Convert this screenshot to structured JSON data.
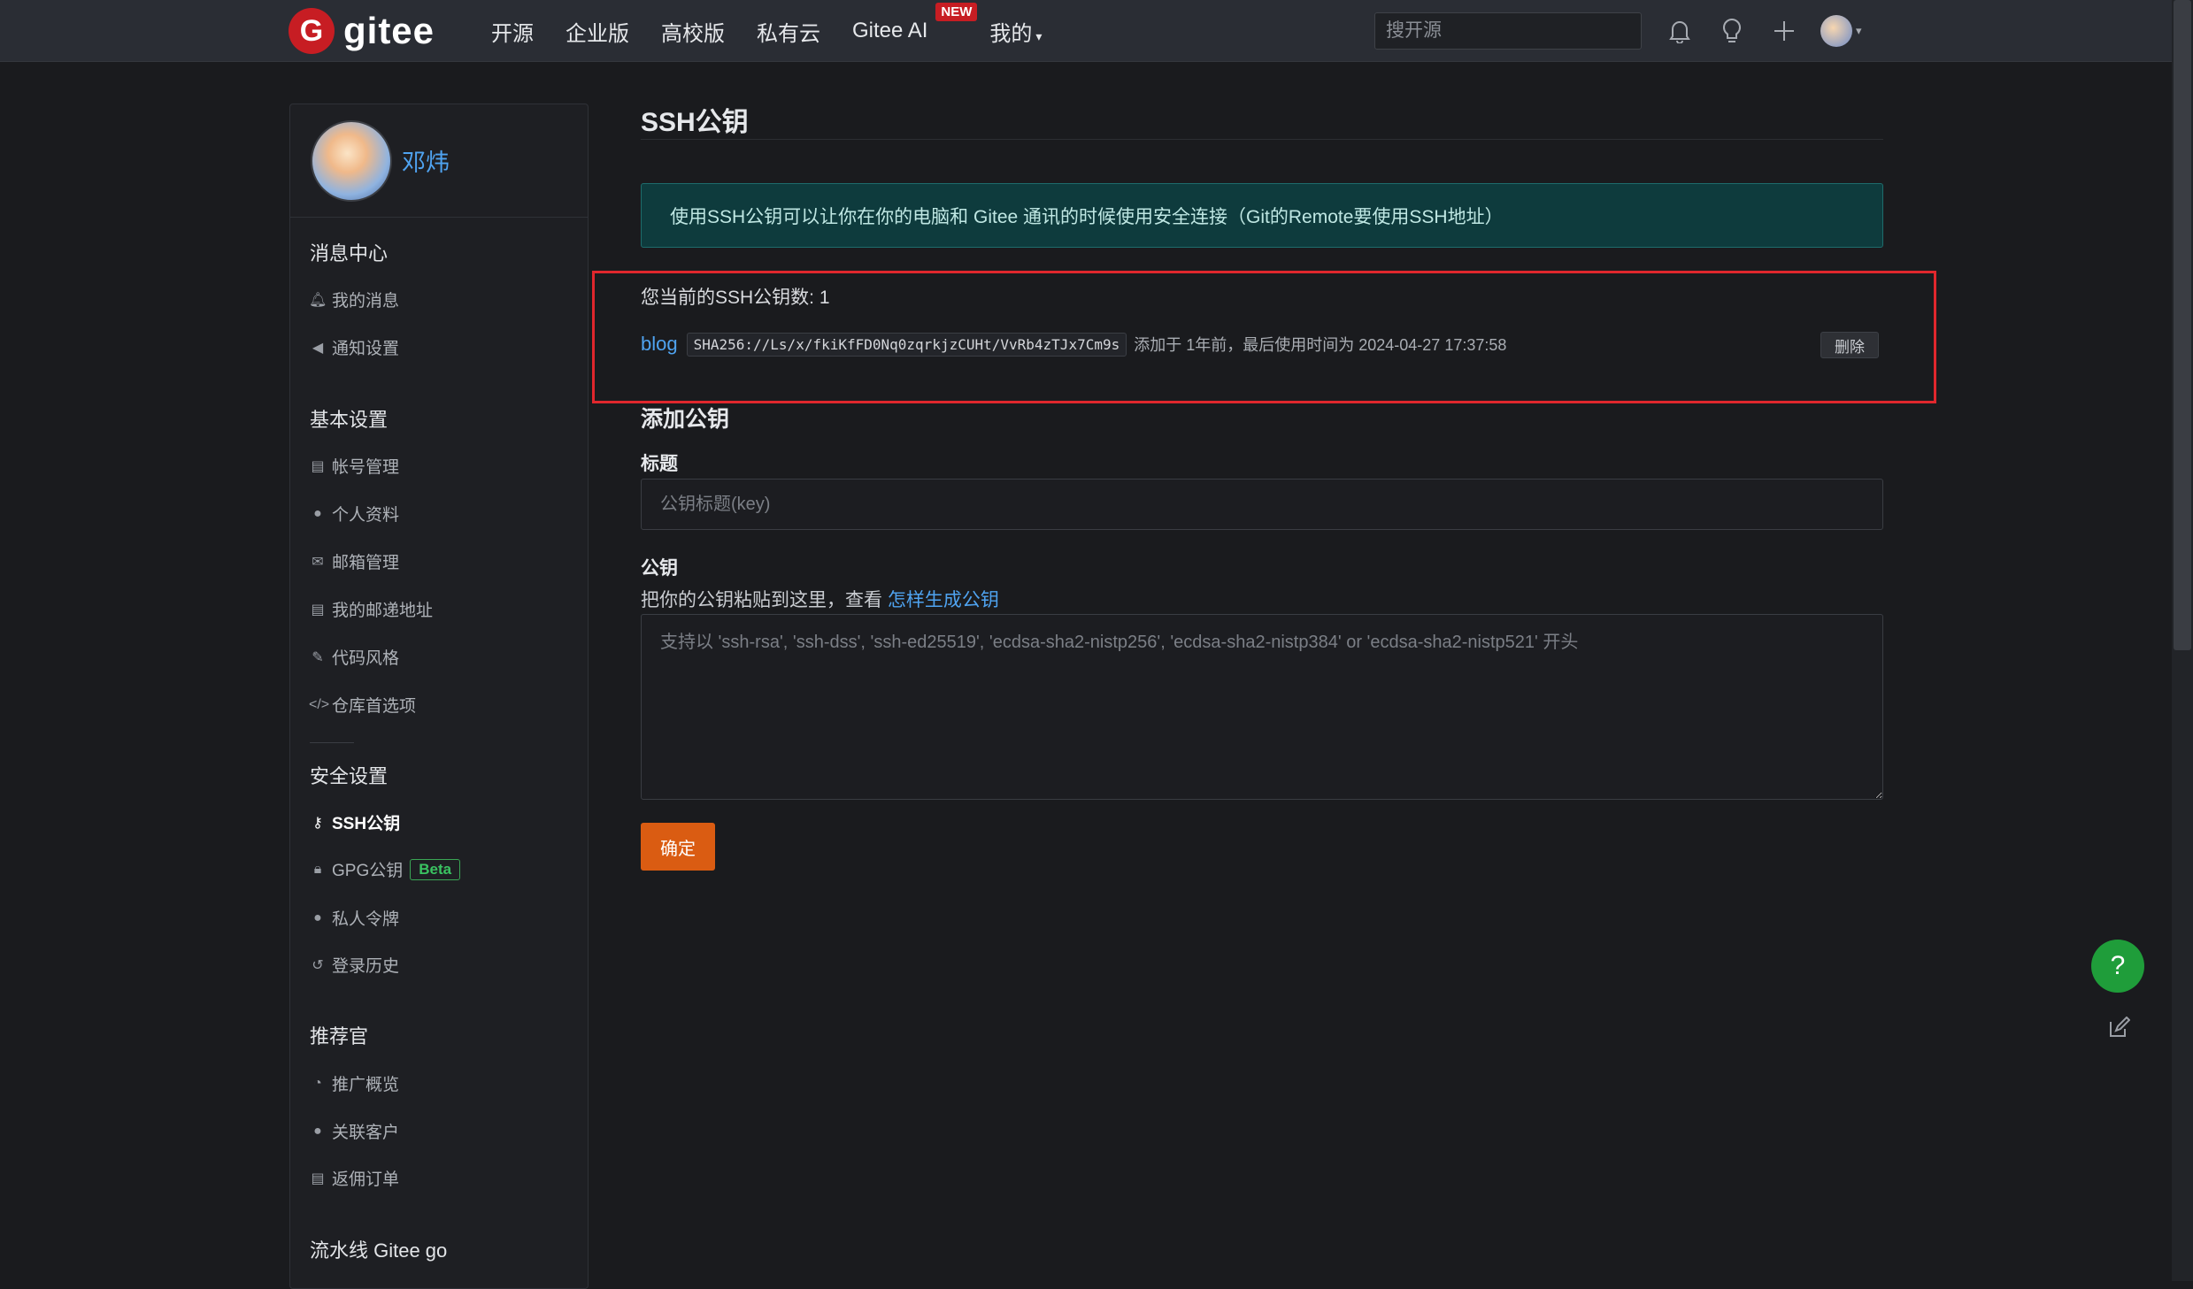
{
  "header": {
    "logo_text": "gitee",
    "logo_mark": "G",
    "nav": [
      "开源",
      "企业版",
      "高校版",
      "私有云",
      "Gitee AI",
      "我的"
    ],
    "new_badge": "NEW",
    "search_placeholder": "搜开源",
    "icons": [
      "bell-icon",
      "lightbulb-icon",
      "plus-icon",
      "avatar"
    ]
  },
  "sidebar": {
    "username": "邓炜",
    "sections": {
      "messages": {
        "title": "消息中心",
        "items": [
          "我的消息",
          "通知设置"
        ]
      },
      "basic": {
        "title": "基本设置",
        "items": [
          "帐号管理",
          "个人资料",
          "邮箱管理",
          "我的邮递地址",
          "代码风格",
          "仓库首选项"
        ]
      },
      "security": {
        "title": "安全设置",
        "items": [
          "SSH公钥",
          "GPG公钥",
          "私人令牌",
          "登录历史"
        ],
        "beta_label": "Beta"
      },
      "referral": {
        "title": "推荐官",
        "items": [
          "推广概览",
          "关联客户",
          "返佣订单"
        ]
      },
      "pipeline": {
        "title": "流水线 Gitee go"
      }
    }
  },
  "main": {
    "title": "SSH公钥",
    "info": "使用SSH公钥可以让你在你的电脑和 Gitee 通讯的时候使用安全连接（Git的Remote要使用SSH地址）",
    "key_count": "您当前的SSH公钥数: 1",
    "keys": [
      {
        "name": "blog",
        "fingerprint": "SHA256://Ls/x/fkiKfFD0Nq0zqrkjzCUHt/VvRb4zTJx7Cm9s",
        "meta": "添加于 1年前，最后使用时间为 2024-04-27 17:37:58",
        "delete_label": "删除"
      }
    ],
    "add_title": "添加公钥",
    "title_label": "标题",
    "title_placeholder": "公钥标题(key)",
    "key_label": "公钥",
    "hint_text": "把你的公钥粘贴到这里，查看 ",
    "hint_link": "怎样生成公钥",
    "key_placeholder": "支持以 'ssh-rsa', 'ssh-dss', 'ssh-ed25519', 'ecdsa-sha2-nistp256', 'ecdsa-sha2-nistp384' or 'ecdsa-sha2-nistp521' 开头",
    "submit_label": "确定"
  },
  "floating": {
    "help_label": "?"
  },
  "colors": {
    "brand_red": "#c71d23",
    "link_blue": "#4fa3f0",
    "submit_orange": "#da5c12",
    "highlight_red": "#e0272d",
    "info_bg": "#0e3b3d",
    "help_green": "#1f9d3a"
  }
}
